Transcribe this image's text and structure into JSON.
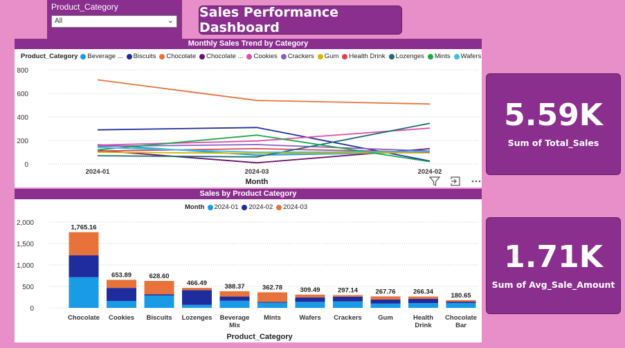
{
  "slicer": {
    "title": "Product_Category",
    "value": "All",
    "chevron_icon": "chevron-down-icon"
  },
  "dashboard_title": "Sales Performance Dashboard",
  "kpis": [
    {
      "value": "5.59K",
      "label": "Sum of Total_Sales"
    },
    {
      "value": "1.71K",
      "label": "Sum of Avg_Sale_Amount"
    }
  ],
  "toolbar": {
    "icons": [
      "filter-icon",
      "focus-mode-icon",
      "more-options-icon"
    ]
  },
  "chart_data": [
    {
      "type": "line",
      "title": "Monthly Sales Trend by Category",
      "xlabel": "Month",
      "ylabel": "",
      "x": [
        "2024-01",
        "2024-03",
        "2024-02"
      ],
      "ylim": [
        0,
        800
      ],
      "yticks": [
        "0",
        "200",
        "400",
        "600",
        "800"
      ],
      "legend_title": "Product_Category",
      "legend_placement": "top",
      "grid": true,
      "series": [
        {
          "name": "Beverage ...",
          "color": "#1a9be6",
          "values": [
            165,
            75,
            100
          ]
        },
        {
          "name": "Biscuits",
          "color": "#1f2c9e",
          "values": [
            290,
            310,
            25
          ]
        },
        {
          "name": "Chocolate",
          "color": "#e8733a",
          "values": [
            715,
            540,
            510
          ]
        },
        {
          "name": "Chocolate ...",
          "color": "#6b0f6b",
          "values": [
            115,
            10,
            130
          ]
        },
        {
          "name": "Cookies",
          "color": "#de4ea8",
          "values": [
            160,
            195,
            305
          ]
        },
        {
          "name": "Crackers",
          "color": "#8a5bbf",
          "values": [
            150,
            165,
            110
          ]
        },
        {
          "name": "Gum",
          "color": "#d9b500",
          "values": [
            100,
            90,
            95
          ]
        },
        {
          "name": "Health Drink",
          "color": "#e0434b",
          "values": [
            110,
            130,
            100
          ]
        },
        {
          "name": "Lozenges",
          "color": "#1c6b73",
          "values": [
            70,
            60,
            345
          ]
        },
        {
          "name": "Mints",
          "color": "#1aa84a",
          "values": [
            120,
            245,
            20
          ]
        },
        {
          "name": "Wafers",
          "color": "#39c1e0",
          "values": [
            140,
            100,
            105
          ]
        }
      ]
    },
    {
      "type": "bar",
      "stacked": true,
      "title": "Sales by Product Category",
      "xlabel": "Product_Category",
      "ylabel": "",
      "categories": [
        "Chocolate",
        "Cookies",
        "Biscuits",
        "Lozenges",
        "Beverage Mix",
        "Mints",
        "Wafers",
        "Crackers",
        "Gum",
        "Health Drink",
        "Chocolate Bar"
      ],
      "totals": [
        "1,765.16",
        "653.89",
        "628.60",
        "466.49",
        "388.37",
        "362.78",
        "309.49",
        "297.14",
        "267.76",
        "266.34",
        "180.65"
      ],
      "ylim": [
        0,
        2000
      ],
      "yticks": [
        "0",
        "500",
        "1,000",
        "1,500",
        "2,000"
      ],
      "legend_title": "Month",
      "legend_placement": "top",
      "grid": true,
      "series": [
        {
          "name": "2024-01",
          "color": "#1a9be6",
          "values": [
            715,
            160,
            290,
            70,
            165,
            120,
            140,
            150,
            100,
            110,
            115
          ]
        },
        {
          "name": "2024-02",
          "color": "#1f2c9e",
          "values": [
            510,
            305,
            25,
            345,
            100,
            20,
            105,
            110,
            95,
            100,
            30
          ]
        },
        {
          "name": "2024-03",
          "color": "#e8733a",
          "values": [
            540,
            189,
            314,
            51,
            123,
            223,
            64,
            37,
            73,
            56,
            36
          ]
        }
      ]
    }
  ]
}
